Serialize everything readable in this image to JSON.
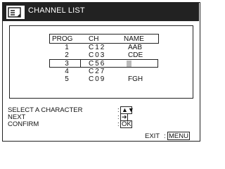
{
  "header": {
    "title": "CHANNEL LIST",
    "icon": "menu-list-icon"
  },
  "table": {
    "columns": [
      "PROG",
      "CH",
      "NAME"
    ],
    "rows": [
      {
        "prog": "1",
        "ch": "C12",
        "name": "AAB"
      },
      {
        "prog": "2",
        "ch": "C03",
        "name": "CDE"
      },
      {
        "prog": "3",
        "ch": "C56",
        "name": ""
      },
      {
        "prog": "4",
        "ch": "C27",
        "name": ""
      },
      {
        "prog": "5",
        "ch": "C09",
        "name": "FGH"
      }
    ],
    "selected_row": 3
  },
  "instructions": [
    {
      "label": "SELECT A CHARACTER",
      "key": "▲▼"
    },
    {
      "label": "NEXT",
      "key": "➔"
    },
    {
      "label": "CONFIRM",
      "key": "OK"
    }
  ],
  "footer": {
    "exit_label": "EXIT",
    "exit_key": "MENU"
  }
}
